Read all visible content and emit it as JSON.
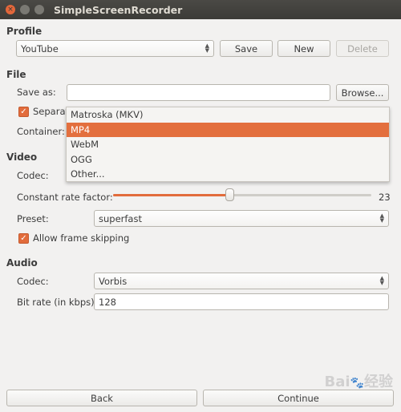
{
  "window": {
    "title": "SimpleScreenRecorder"
  },
  "profile": {
    "heading": "Profile",
    "selected": "YouTube",
    "save": "Save",
    "new": "New",
    "delete": "Delete"
  },
  "file": {
    "heading": "File",
    "save_as_label": "Save as:",
    "save_as_value": "",
    "browse": "Browse...",
    "separate_label": "Separat",
    "separate_checked": true,
    "container_label": "Container:",
    "container_options": [
      "Matroska (MKV)",
      "MP4",
      "WebM",
      "OGG",
      "Other..."
    ],
    "container_selected": "MP4"
  },
  "video": {
    "heading": "Video",
    "codec_label": "Codec:",
    "crf_label": "Constant rate factor:",
    "crf_value": "23",
    "crf_range": [
      0,
      51
    ],
    "preset_label": "Preset:",
    "preset_value": "superfast",
    "frame_skip_label": "Allow frame skipping",
    "frame_skip_checked": true
  },
  "audio": {
    "heading": "Audio",
    "codec_label": "Codec:",
    "codec_value": "Vorbis",
    "bitrate_label": "Bit rate (in kbps):",
    "bitrate_value": "128"
  },
  "footer": {
    "back": "Back",
    "continue": "Continue"
  },
  "watermark": "Baidu 经验",
  "colors": {
    "accent": "#e26c3c",
    "titlebar": "#3c3b37",
    "background": "#f2f1f0"
  }
}
